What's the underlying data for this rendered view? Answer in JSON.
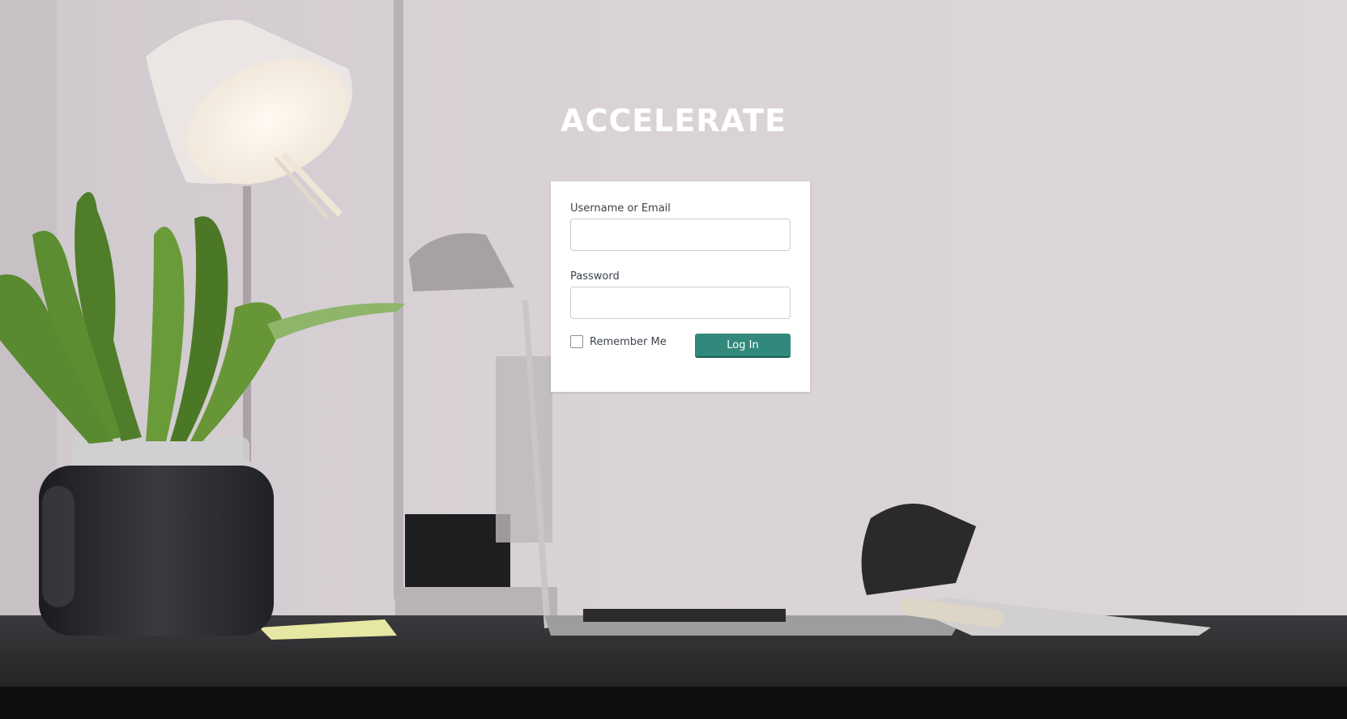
{
  "brand": {
    "title": "ACCELERATE"
  },
  "login_form": {
    "username_label": "Username or Email",
    "username_value": "",
    "password_label": "Password",
    "password_value": "",
    "remember_label": "Remember Me",
    "remember_checked": false,
    "submit_label": "Log In"
  },
  "colors": {
    "button": "#30897a",
    "wall": "#d9d3d6",
    "desk": "#2a2a2c"
  },
  "background": {
    "scene": "desk-with-lamp-plant-laptop-photo"
  }
}
